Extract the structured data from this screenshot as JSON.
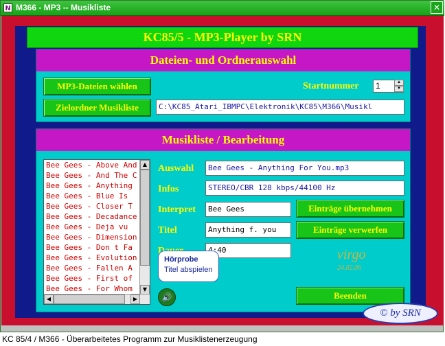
{
  "window": {
    "title": "M366 - MP3 -- Musikliste",
    "app_icon": "app-icon",
    "close_glyph": "✕"
  },
  "header": {
    "title": "KC85/5 - MP3-Player by SRN"
  },
  "files_panel": {
    "title": "Dateien- und Ordnerauswahl",
    "select_mp3_button": "MP3-Dateien wählen",
    "target_folder_button": "Zielordner Musikliste",
    "start_number_label": "Startnummer",
    "start_number_value": "1",
    "target_path": "C:\\KC85_Atari_IBMPC\\Elektronik\\KC85\\M366\\Musikl"
  },
  "music_panel": {
    "title": "Musikliste / Bearbeitung",
    "list_items": [
      "Bee Gees - Above And",
      "Bee Gees - And The C",
      "Bee Gees - Anything",
      "Bee Gees - Blue Is",
      "Bee Gees - Closer T",
      "Bee Gees - Decadance",
      "Bee Gees - Deja vu",
      "Bee Gees - Dimension",
      "Bee Gees - Don t Fa",
      "Bee Gees - Evolution",
      "Bee Gees - Fallen A",
      "Bee Gees - First of",
      "Bee Gees - For Whom"
    ],
    "labels": {
      "selection": "Auswahl",
      "infos": "Infos",
      "artist": "Interpret",
      "title": "Titel",
      "duration": "Dauer"
    },
    "values": {
      "selection": "Bee Gees - Anything For You.mp3",
      "infos": "STEREO/CBR 128 kbps/44100 Hz",
      "artist": "Bee Gees",
      "title": "Anything f. you",
      "duration": "4:40"
    },
    "apply_button": "Einträge übernehmen",
    "discard_button": "Einträge verwerfen",
    "exit_button": "Beenden",
    "tooltip_title": "Hörprobe",
    "tooltip_text": "Titel abspielen",
    "watermark_text": "virgo",
    "watermark_date": "24.02.06"
  },
  "badge": "© by SRN",
  "status_bar": "KC 85/4 / M366 - Überarbeitetes Programm zur Musiklistenerzeugung"
}
